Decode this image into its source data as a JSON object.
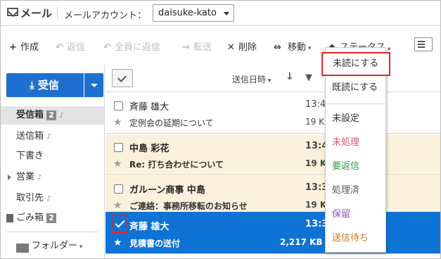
{
  "header": {
    "app_title": "メール",
    "account_label": "メールアカウント：",
    "account_value": "daisuke-kato"
  },
  "toolbar": {
    "compose": "作成",
    "reply": "返信",
    "reply_all": "全員に返信",
    "forward": "転送",
    "delete": "削除",
    "move": "移動",
    "status": "ステータス"
  },
  "sidebar": {
    "receive_label": "受信",
    "folders": [
      {
        "label": "受信箱",
        "badge": "2"
      },
      {
        "label": "送信箱"
      },
      {
        "label": "下書き"
      },
      {
        "label": "営業"
      },
      {
        "label": "取引先"
      },
      {
        "label": "ごみ箱",
        "badge": "2"
      }
    ],
    "folder_menu": "フォルダー"
  },
  "list": {
    "sort_label": "送信日時",
    "rows": [
      {
        "sender": "斉藤 雄大",
        "subject": "定例会の延期について",
        "time": "13:4",
        "size": "19 K",
        "unread": false,
        "state": "normal"
      },
      {
        "sender": "中島 彩花",
        "subject": "Re: 打ち合わせについて",
        "time": "13:4",
        "size": "19 K",
        "unread": true,
        "state": "highlight"
      },
      {
        "sender": "ガルーン商事 中島",
        "subject": "ご連絡：事務所移転のお知らせ",
        "time": "13:3",
        "size": "19 K",
        "unread": true,
        "state": "highlight"
      },
      {
        "sender": "斉藤 雄大",
        "subject": "見積書の送付",
        "time": "13:3",
        "size": "2,217 KB",
        "unread": true,
        "state": "selected"
      }
    ]
  },
  "status_menu": {
    "items": [
      {
        "label": "未読にする",
        "color": "#333333"
      },
      {
        "label": "既読にする",
        "color": "#333333"
      },
      {
        "label": "未設定",
        "color": "#333333"
      },
      {
        "label": "未処理",
        "color": "#e0526f"
      },
      {
        "label": "要返信",
        "color": "#2e9a46"
      },
      {
        "label": "処理済",
        "color": "#555555"
      },
      {
        "label": "保留",
        "color": "#8b58c2"
      },
      {
        "label": "送信待ち",
        "color": "#c9772a"
      }
    ]
  },
  "colors": {
    "accent": "#1f6fd0",
    "selected_row": "#0f73d6",
    "highlight_row": "#fcf1dd",
    "callout": "#e0262b"
  }
}
